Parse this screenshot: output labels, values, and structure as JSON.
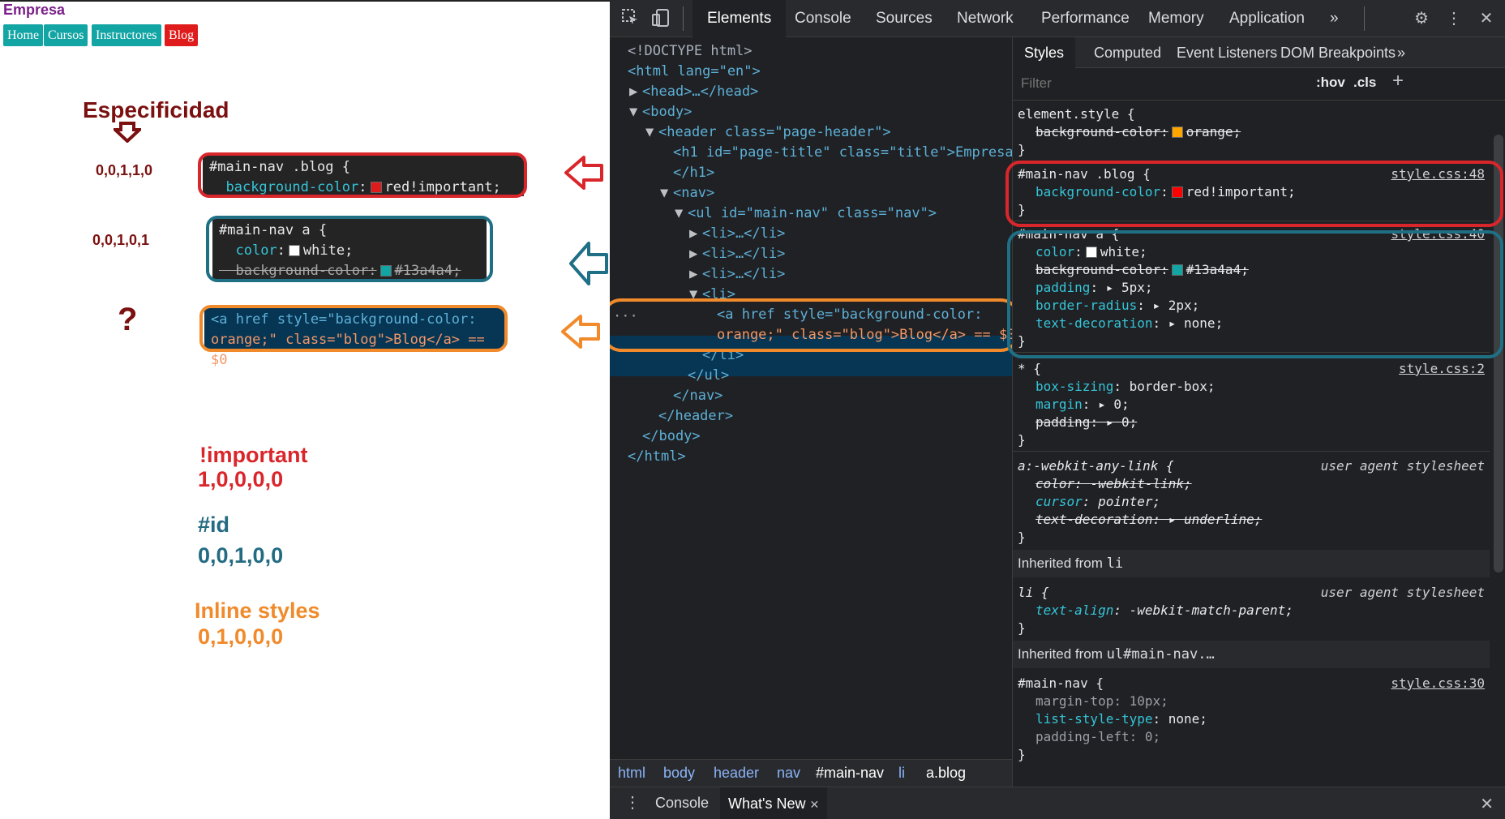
{
  "page": {
    "site_title": "Empresa",
    "nav": [
      "Home",
      "Cursos",
      "Instructores",
      "Blog"
    ]
  },
  "annotations": {
    "heading": "Especificidad",
    "rows": [
      {
        "spec": "0,0,1,1,0",
        "selector": "#main-nav .blog {",
        "prop": "background-color",
        "value": "red!important;",
        "swatch": "#e01b1b"
      },
      {
        "spec": "0,0,1,0,1",
        "selector": "#main-nav a {",
        "prop1": "color",
        "value1": "white;",
        "swatch1": "#ffffff",
        "prop2": "background-color",
        "value2": "#13a4a4;",
        "swatch2": "#13a4a4"
      },
      {
        "spec": "?",
        "line1": "<a href style=\"background-color:",
        "line2": "orange;\" class=\"blog\">Blog</a> == $0"
      }
    ],
    "legend": [
      {
        "title": "!important",
        "value": "1,0,0,0,0",
        "color": "#d9262b"
      },
      {
        "title": "#id",
        "value": "0,0,1,0,0",
        "color": "#236b82"
      },
      {
        "title": "Inline styles",
        "value": "0,1,0,0,0",
        "color": "#f08a2b"
      }
    ],
    "colors": {
      "red": "#d9262b",
      "teal": "#1f6f85",
      "orange": "#f08a2b",
      "maroon": "#7b1010"
    }
  },
  "devtools": {
    "tabs": [
      "Elements",
      "Console",
      "Sources",
      "Network",
      "Performance",
      "Memory",
      "Application"
    ],
    "more": "»",
    "dom": {
      "doctype": "<!DOCTYPE html>",
      "html_open": "<html lang=\"en\">",
      "head": "<head>…</head>",
      "body_open": "<body>",
      "header_open": "<header class=\"page-header\">",
      "h1": "<h1 id=\"page-title\" class=\"title\">Empresa",
      "h1_close": "</h1>",
      "nav_open": "<nav>",
      "ul_open": "<ul id=\"main-nav\" class=\"nav\">",
      "li_collapsed": "<li>…</li>",
      "li_open": "<li>",
      "sel_line1": "<a href style=\"background-color:",
      "sel_line2": "orange;\" class=\"blog\">Blog</a> == $0",
      "li_close": "</li>",
      "ul_close": "</ul>",
      "nav_close": "</nav>",
      "header_close": "</header>",
      "body_close": "</body>",
      "html_close": "</html>"
    },
    "breadcrumbs": [
      "html",
      "body",
      "header",
      "nav",
      "#main-nav",
      "li",
      "a.blog"
    ],
    "subtabs": [
      "Styles",
      "Computed",
      "Event Listeners",
      "DOM Breakpoints"
    ],
    "filter_placeholder": "Filter",
    "hov": ":hov",
    "cls": ".cls",
    "styles": {
      "element_style": "element.style {",
      "es_prop": "background-color",
      "es_value": "orange;",
      "r1_sel": "#main-nav .blog {",
      "r1_src": "style.css:48",
      "r1_prop": "background-color",
      "r1_value": "red!important;",
      "r2_sel": "#main-nav a {",
      "r2_src": "style.css:40",
      "r2_p1": "color",
      "r2_v1": "white;",
      "r2_p2": "background-color",
      "r2_v2": "#13a4a4;",
      "r2_p3": "padding",
      "r2_v3": "5px;",
      "r2_p4": "border-radius",
      "r2_v4": "2px;",
      "r2_p5": "text-decoration",
      "r2_v5": "none;",
      "r3_sel": "* {",
      "r3_src": "style.css:2",
      "r3_p1": "box-sizing",
      "r3_v1": "border-box;",
      "r3_p2": "margin",
      "r3_v2": "0;",
      "r3_p3": "padding",
      "r3_v3": "0;",
      "r4_sel": "a:-webkit-any-link {",
      "r4_src": "user agent stylesheet",
      "r4_p1": "color",
      "r4_v1": "-webkit-link;",
      "r4_p2": "cursor",
      "r4_v2": "pointer;",
      "r4_p3": "text-decoration",
      "r4_v3": "underline;",
      "inh1_label": "Inherited from",
      "inh1_target": "li",
      "r5_sel": "li {",
      "r5_src": "user agent stylesheet",
      "r5_p1": "text-align",
      "r5_v1": "-webkit-match-parent;",
      "inh2_label": "Inherited from",
      "inh2_target": "ul#main-nav.…",
      "r6_sel": "#main-nav {",
      "r6_src": "style.css:30",
      "r6_p1": "margin-top",
      "r6_v1": "10px;",
      "r6_p2": "list-style-type",
      "r6_v2": "none;",
      "r6_p3": "padding-left",
      "r6_v3": "0;",
      "close": "}"
    },
    "drawer_tabs": [
      "Console",
      "What's New"
    ]
  }
}
